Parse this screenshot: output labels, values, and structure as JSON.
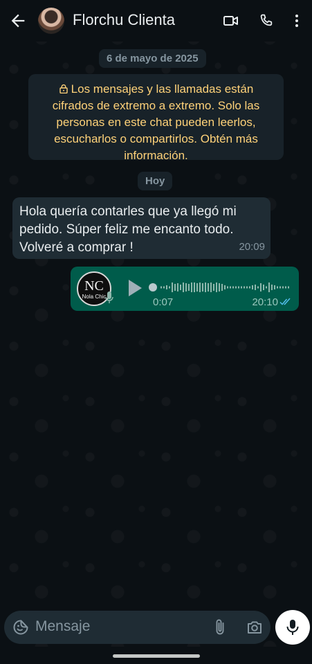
{
  "header": {
    "contact_name": "Florchu Clienta",
    "icons": [
      "back-arrow-icon",
      "video-call-icon",
      "phone-icon",
      "more-vert-icon"
    ]
  },
  "chat": {
    "date_chip": "6 de mayo de 2025",
    "encryption_notice": "Los mensajes y las llamadas están cifrados de extremo a extremo. Solo las personas en este chat pueden leerlos, escucharlos o compartirlos. Obtén más información.",
    "day_chip": "Hoy",
    "messages": [
      {
        "direction": "incoming",
        "text": "Hola quería contarles que ya llegó mi pedido. Súper feliz me encanto todo. Volveré a comprar !",
        "time": "20:09"
      },
      {
        "direction": "outgoing",
        "type": "voice",
        "sender_logo_letters": "NC",
        "sender_logo_name": "Nola Chic",
        "duration": "0:07",
        "time": "20:10",
        "status": "read"
      }
    ]
  },
  "composer": {
    "placeholder": "Mensaje"
  },
  "colors": {
    "background": "#0b1014",
    "incoming_bubble": "#1f2c34",
    "outgoing_bubble": "#005c4b",
    "notice_text": "#ffd279",
    "read_check": "#53bdeb"
  }
}
